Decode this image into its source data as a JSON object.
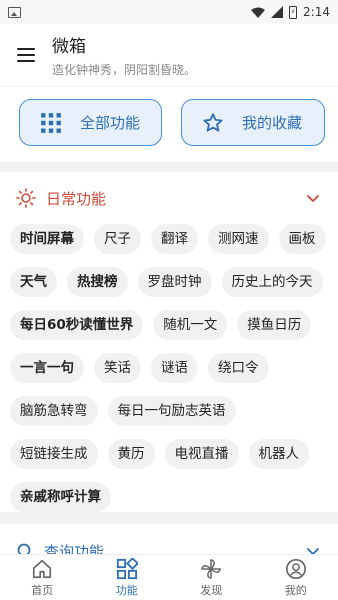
{
  "status_bar": {
    "time": "2:14",
    "battery_glyph": "⚡"
  },
  "app_bar": {
    "title": "微箱",
    "subtitle": "造化钟神秀，阴阳割昏晓。"
  },
  "quick_buttons": {
    "all_features": "全部功能",
    "my_favorites": "我的收藏"
  },
  "daily_section": {
    "title": "日常功能",
    "chips": [
      {
        "label": "时间屏幕",
        "bold": true
      },
      {
        "label": "尺子",
        "bold": false
      },
      {
        "label": "翻译",
        "bold": false
      },
      {
        "label": "测网速",
        "bold": false
      },
      {
        "label": "画板",
        "bold": false
      },
      {
        "label": "天气",
        "bold": true
      },
      {
        "label": "热搜榜",
        "bold": true
      },
      {
        "label": "罗盘时钟",
        "bold": false
      },
      {
        "label": "历史上的今天",
        "bold": false
      },
      {
        "label": "每日60秒读懂世界",
        "bold": true
      },
      {
        "label": "随机一文",
        "bold": false
      },
      {
        "label": "摸鱼日历",
        "bold": false
      },
      {
        "label": "一言一句",
        "bold": true
      },
      {
        "label": "笑话",
        "bold": false
      },
      {
        "label": "谜语",
        "bold": false
      },
      {
        "label": "绕口令",
        "bold": false
      },
      {
        "label": "脑筋急转弯",
        "bold": false
      },
      {
        "label": "每日一句励志英语",
        "bold": false
      },
      {
        "label": "短链接生成",
        "bold": false
      },
      {
        "label": "黄历",
        "bold": false
      },
      {
        "label": "电视直播",
        "bold": false
      },
      {
        "label": "机器人",
        "bold": false
      },
      {
        "label": "亲戚称呼计算",
        "bold": true
      }
    ]
  },
  "query_section": {
    "title": "查询功能"
  },
  "bottom_nav": [
    {
      "label": "首页",
      "icon": "home-icon",
      "active": false
    },
    {
      "label": "功能",
      "icon": "grid-icon",
      "active": true
    },
    {
      "label": "发现",
      "icon": "pinwheel-icon",
      "active": false
    },
    {
      "label": "我的",
      "icon": "user-icon",
      "active": false
    }
  ],
  "colors": {
    "accent_blue": "#2e6fb5",
    "accent_red": "#d04a3a",
    "chip_bg": "#f1f1f1"
  }
}
